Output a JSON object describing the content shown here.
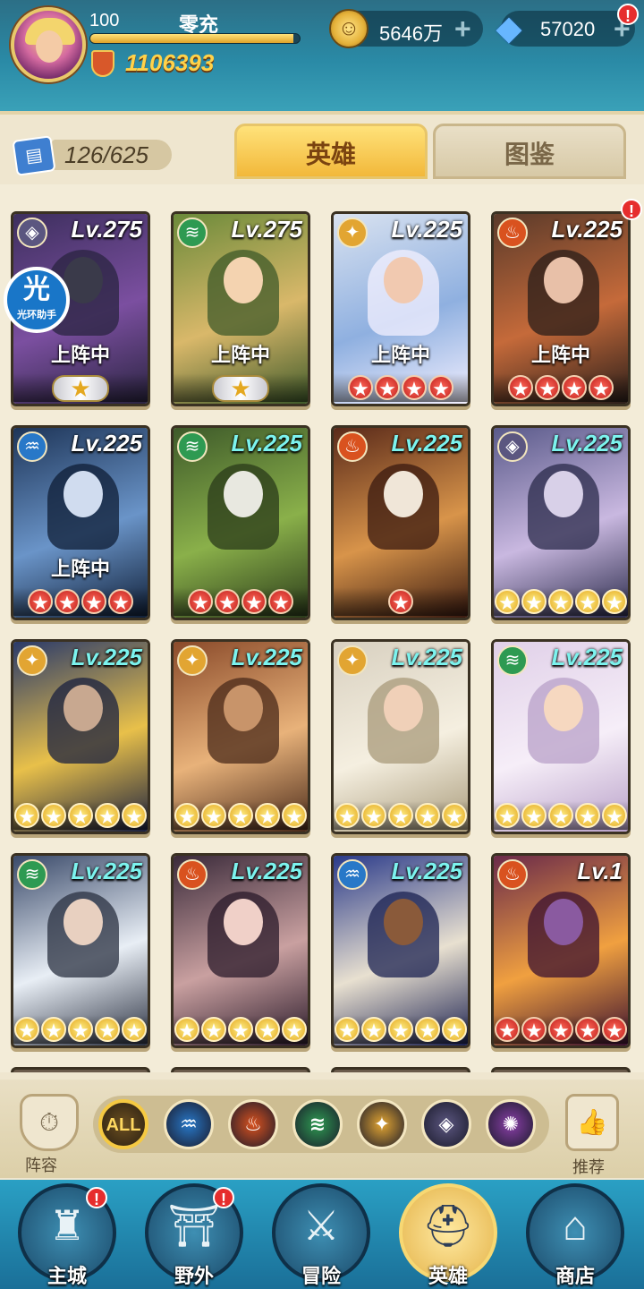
{
  "player": {
    "level": "100",
    "name": "零充",
    "exp_fraction": 0.97,
    "power": "1106393"
  },
  "currency": {
    "gold": "5646万",
    "gems": "57020"
  },
  "tabs": {
    "heroes": "英雄",
    "codex": "图鉴"
  },
  "collection": {
    "count": "126/625"
  },
  "assist_badge": {
    "glyph": "光",
    "label": "光环助手"
  },
  "heroes": [
    {
      "level": "Lv.275",
      "element": "dark-diamond-icon",
      "deployed": "上阵中",
      "star_type": "wing",
      "stars": 1,
      "lv_color": "white"
    },
    {
      "level": "Lv.275",
      "element": "wind-icon",
      "deployed": "上阵中",
      "star_type": "wing",
      "stars": 1,
      "lv_color": "white"
    },
    {
      "level": "Lv.225",
      "element": "light-icon",
      "deployed": "上阵中",
      "star_type": "red",
      "stars": 4,
      "lv_color": "white"
    },
    {
      "level": "Lv.225",
      "element": "fire-icon",
      "deployed": "上阵中",
      "star_type": "red",
      "stars": 4,
      "lv_color": "white"
    },
    {
      "level": "Lv.225",
      "element": "water-icon",
      "deployed": "上阵中",
      "star_type": "red",
      "stars": 4,
      "lv_color": "white"
    },
    {
      "level": "Lv.225",
      "element": "wind-icon",
      "deployed": "",
      "star_type": "red",
      "stars": 4,
      "lv_color": "cyan"
    },
    {
      "level": "Lv.225",
      "element": "fire-icon",
      "deployed": "",
      "star_type": "red",
      "stars": 1,
      "lv_color": "cyan"
    },
    {
      "level": "Lv.225",
      "element": "dark-diamond-icon",
      "deployed": "",
      "star_type": "yellow",
      "stars": 5,
      "lv_color": "cyan"
    },
    {
      "level": "Lv.225",
      "element": "light-icon",
      "deployed": "",
      "star_type": "yellow",
      "stars": 5,
      "lv_color": "cyan"
    },
    {
      "level": "Lv.225",
      "element": "light-icon",
      "deployed": "",
      "star_type": "yellow",
      "stars": 5,
      "lv_color": "cyan"
    },
    {
      "level": "Lv.225",
      "element": "light-icon",
      "deployed": "",
      "star_type": "yellow",
      "stars": 5,
      "lv_color": "cyan"
    },
    {
      "level": "Lv.225",
      "element": "wind-icon",
      "deployed": "",
      "star_type": "yellow",
      "stars": 5,
      "lv_color": "cyan"
    },
    {
      "level": "Lv.225",
      "element": "wind-icon",
      "deployed": "",
      "star_type": "yellow",
      "stars": 5,
      "lv_color": "cyan"
    },
    {
      "level": "Lv.225",
      "element": "fire-icon",
      "deployed": "",
      "star_type": "yellow",
      "stars": 5,
      "lv_color": "cyan"
    },
    {
      "level": "Lv.225",
      "element": "water-icon",
      "deployed": "",
      "star_type": "yellow",
      "stars": 5,
      "lv_color": "cyan"
    },
    {
      "level": "Lv.1",
      "element": "fire-icon",
      "deployed": "",
      "star_type": "red",
      "stars": 5,
      "lv_color": "white"
    }
  ],
  "filters": {
    "lineup": "阵容",
    "recommend": "推荐",
    "all": "ALL",
    "elements": [
      "water-icon",
      "fire-icon",
      "wind-icon",
      "light-icon",
      "dark-diamond-icon",
      "purple-spiral-icon"
    ]
  },
  "nav": [
    {
      "label": "主城",
      "icon": "castle-icon",
      "alert": true,
      "active": false
    },
    {
      "label": "野外",
      "icon": "gate-icon",
      "alert": true,
      "active": false
    },
    {
      "label": "冒险",
      "icon": "sword-icon",
      "alert": false,
      "active": false
    },
    {
      "label": "英雄",
      "icon": "helmet-icon",
      "alert": false,
      "active": true
    },
    {
      "label": "商店",
      "icon": "shop-icon",
      "alert": false,
      "active": false
    }
  ],
  "colors": {
    "fire": "#d9521f",
    "water": "#2878c8",
    "wind": "#2e9a52",
    "light": "#e2a532",
    "dark": "#5b5680",
    "purple": "#8a3fa8",
    "alert": "#e62d2d"
  }
}
